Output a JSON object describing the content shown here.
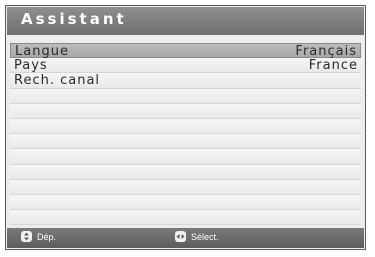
{
  "header": {
    "title": "Assistant"
  },
  "menu": {
    "items": [
      {
        "label": "Langue",
        "value": "Français",
        "selected": true
      },
      {
        "label": "Pays",
        "value": "France",
        "selected": false
      },
      {
        "label": "Rech. canal",
        "value": "",
        "selected": false
      },
      {
        "label": "",
        "value": "",
        "selected": false
      },
      {
        "label": "",
        "value": "",
        "selected": false
      },
      {
        "label": "",
        "value": "",
        "selected": false
      },
      {
        "label": "",
        "value": "",
        "selected": false
      },
      {
        "label": "",
        "value": "",
        "selected": false
      },
      {
        "label": "",
        "value": "",
        "selected": false
      },
      {
        "label": "",
        "value": "",
        "selected": false
      },
      {
        "label": "",
        "value": "",
        "selected": false
      },
      {
        "label": "",
        "value": "",
        "selected": false
      }
    ]
  },
  "footer": {
    "hints": [
      {
        "icon": "up-down-arrows-icon",
        "label": "Dép."
      },
      {
        "icon": "left-right-arrows-icon",
        "label": "Sélect."
      }
    ]
  },
  "colors": {
    "header": "#7f7f7f",
    "footer": "#6a6a6a",
    "selected_row": "#b3b3b3",
    "panel": "#ededed"
  }
}
